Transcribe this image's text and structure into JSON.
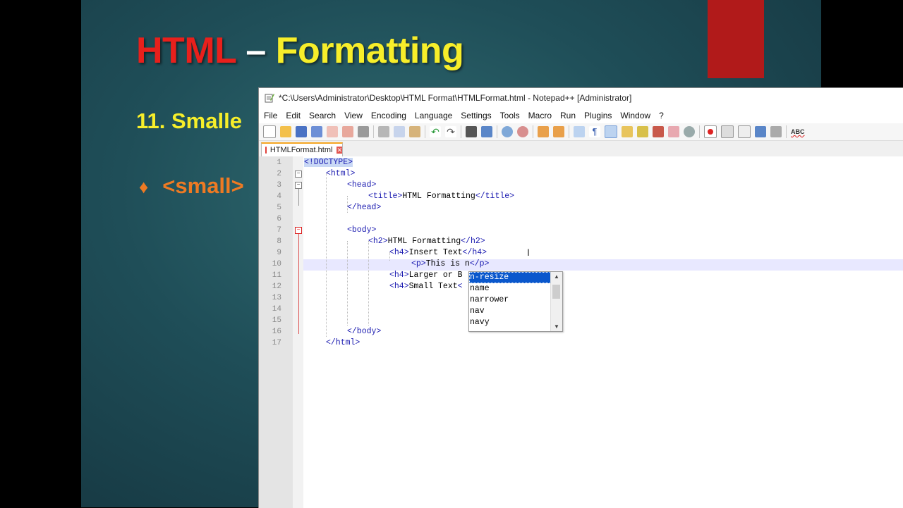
{
  "slide": {
    "title_html": "HTML",
    "title_dash": "–",
    "title_formatting": "Formatting",
    "subtitle": "11. Smalle",
    "bullet_symbol": "♦",
    "bullet_text": "<small>"
  },
  "notepad": {
    "window_title": "*C:\\Users\\Administrator\\Desktop\\HTML Format\\HTMLFormat.html - Notepad++ [Administrator]",
    "menu": [
      "File",
      "Edit",
      "Search",
      "View",
      "Encoding",
      "Language",
      "Settings",
      "Tools",
      "Macro",
      "Run",
      "Plugins",
      "Window",
      "?"
    ],
    "tab_label": "HTMLFormat.html",
    "tab_close": "✕",
    "line_numbers": [
      "1",
      "2",
      "3",
      "4",
      "5",
      "6",
      "7",
      "8",
      "9",
      "10",
      "11",
      "12",
      "13",
      "14",
      "15",
      "16",
      "17"
    ],
    "code_lines": [
      {
        "tag1": "<!DOCTYPE>",
        "text": "",
        "tag2": ""
      },
      {
        "tag1": "<html>",
        "text": "",
        "tag2": ""
      },
      {
        "tag1": "<head>",
        "text": "",
        "tag2": ""
      },
      {
        "tag1": "<title>",
        "text": "HTML Formatting",
        "tag2": "</title>"
      },
      {
        "tag1": "</head>",
        "text": "",
        "tag2": ""
      },
      {
        "tag1": "",
        "text": "",
        "tag2": ""
      },
      {
        "tag1": "<body>",
        "text": "",
        "tag2": ""
      },
      {
        "tag1": "<h2>",
        "text": "HTML Formatting",
        "tag2": "</h2>"
      },
      {
        "tag1": "<h4>",
        "text": "Insert Text",
        "tag2": "</h4>"
      },
      {
        "tag1": "<p>",
        "text": "This is n",
        "tag2": "</p>"
      },
      {
        "tag1": "<h4>",
        "text": "Larger or B",
        "tag2": ""
      },
      {
        "tag1": "<h4>",
        "text": "Small Text",
        "tag2": "<"
      },
      {
        "tag1": "",
        "text": "",
        "tag2": ""
      },
      {
        "tag1": "",
        "text": "",
        "tag2": ""
      },
      {
        "tag1": "",
        "text": "",
        "tag2": ""
      },
      {
        "tag1": "</body>",
        "text": "",
        "tag2": ""
      },
      {
        "tag1": "</html>",
        "text": "",
        "tag2": ""
      }
    ],
    "autocomplete": [
      "n-resize",
      "name",
      "narrower",
      "nav",
      "navy"
    ],
    "toolbar_icons": [
      "new-file-icon",
      "open-file-icon",
      "save-icon",
      "save-all-icon",
      "close-icon",
      "close-all-icon",
      "print-icon",
      "cut-icon",
      "copy-icon",
      "paste-icon",
      "undo-icon",
      "redo-icon",
      "find-icon",
      "replace-icon",
      "zoom-in-icon",
      "zoom-out-icon",
      "sync-v-icon",
      "sync-h-icon",
      "word-wrap-icon",
      "show-all-chars-icon",
      "indent-guide-icon",
      "doc-map-icon",
      "function-list-icon",
      "folder-workspace-icon",
      "monitoring-icon",
      "record-macro-icon",
      "stop-record-icon",
      "play-macro-icon",
      "run-macro-multiple-icon",
      "save-macro-icon",
      "spell-check-icon"
    ],
    "spell_label": "ABC"
  }
}
